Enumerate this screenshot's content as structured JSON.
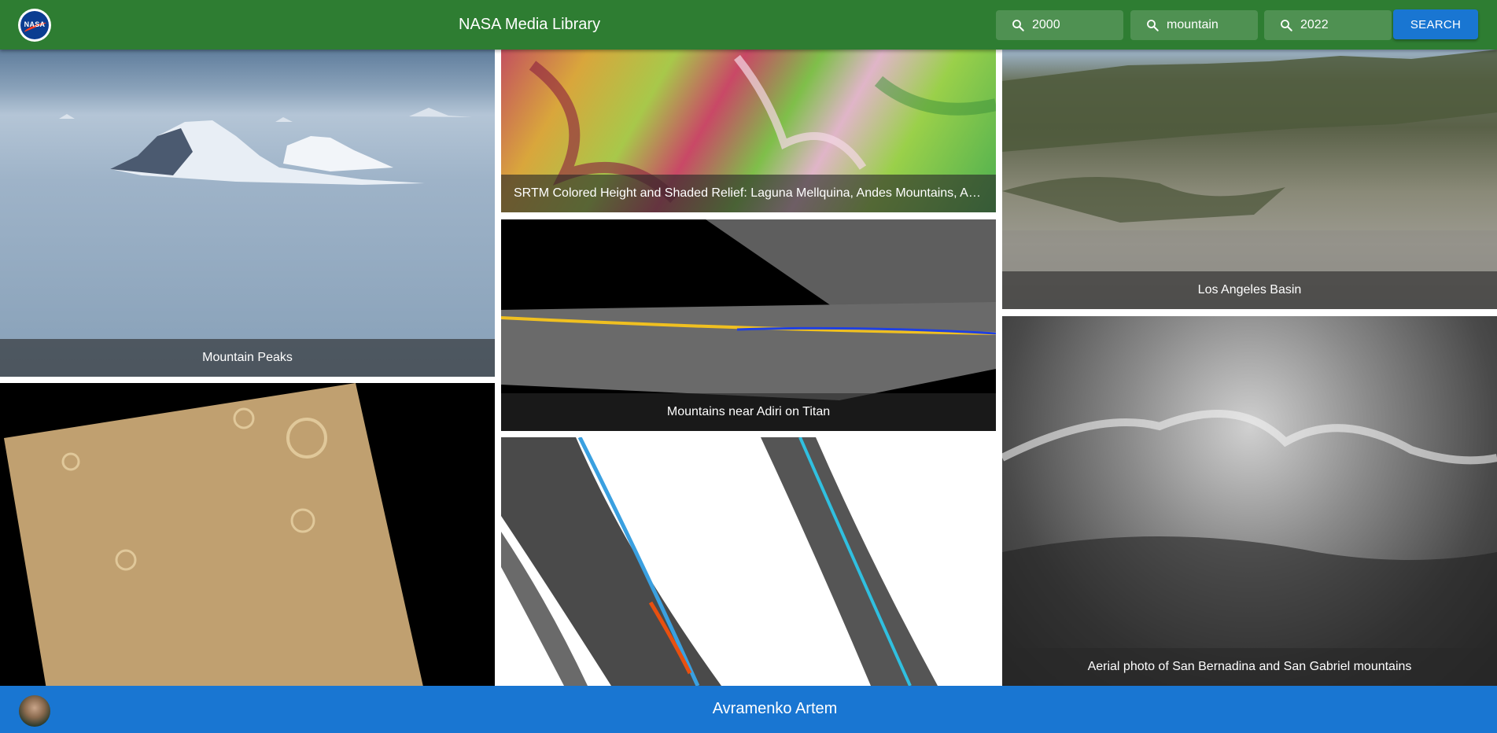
{
  "header": {
    "logo_text": "NASA",
    "title": "NASA Media Library",
    "search_fields": [
      {
        "value": "2000",
        "icon": "search-icon"
      },
      {
        "value": "mountain",
        "icon": "search-icon"
      },
      {
        "value": "2022",
        "icon": "search-icon"
      }
    ],
    "search_button_label": "SEARCH"
  },
  "gallery": {
    "items": [
      {
        "caption": "Mountain Peaks"
      },
      {
        "caption": "SRTM Colored Height and Shaded Relief: Laguna Mellquina, Andes Mountains, Argentina"
      },
      {
        "caption": "Los Angeles Basin"
      },
      {
        "caption": "Mountains near Adiri on Titan"
      },
      {
        "caption": ""
      },
      {
        "caption": ""
      },
      {
        "caption": "Aerial photo of San Bernadina and San Gabriel mountains"
      }
    ]
  },
  "footer": {
    "author": "Avramenko Artem"
  },
  "colors": {
    "header": "#2e7d32",
    "footer": "#1976d2",
    "button": "#1976d2"
  }
}
